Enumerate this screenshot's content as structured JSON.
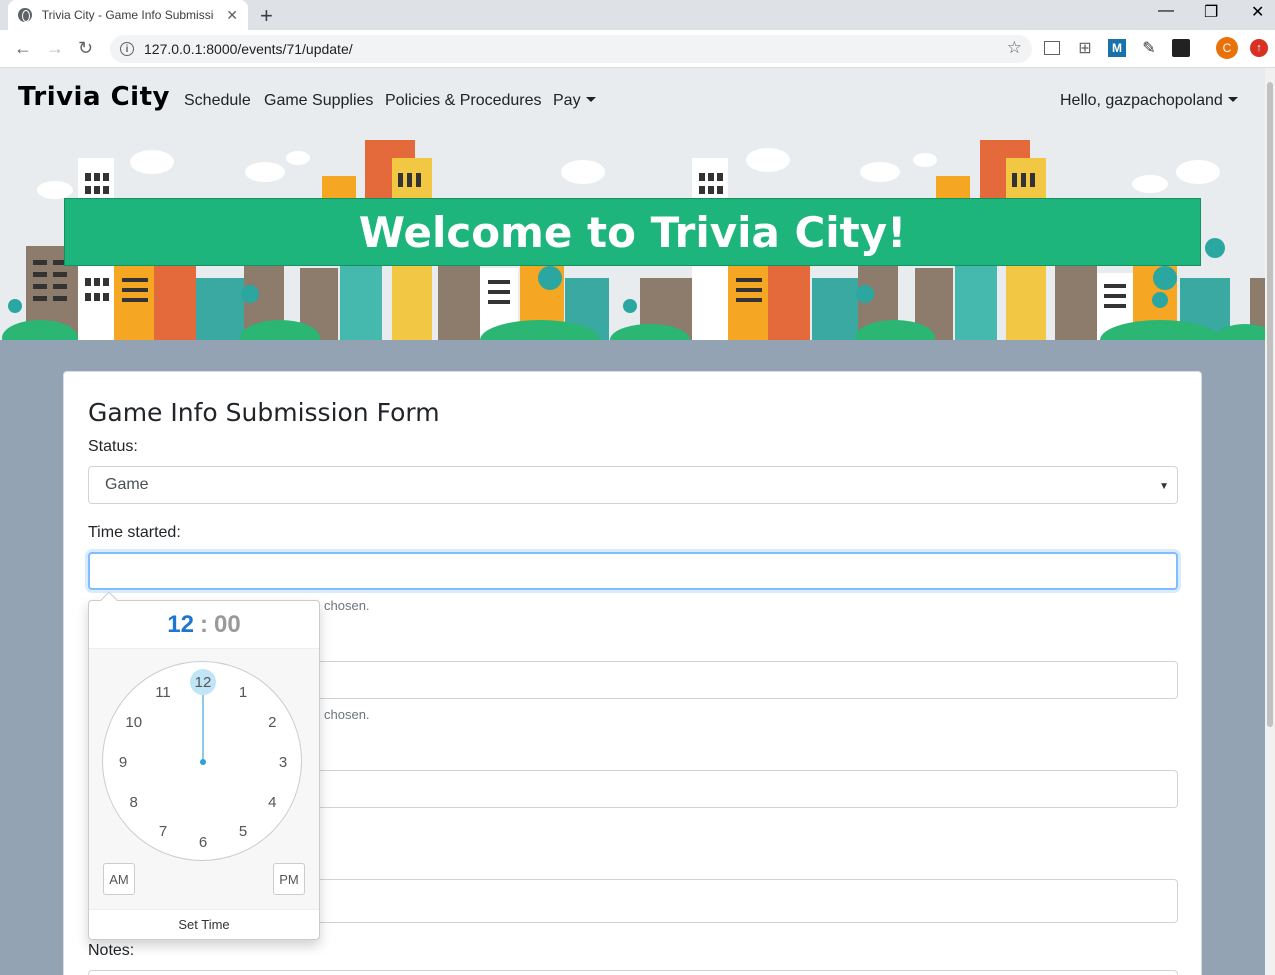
{
  "browser": {
    "tab_title": "Trivia City - Game Info Submissio",
    "tab_close": "✕",
    "new_tab": "+",
    "url": "127.0.0.1:8000/events/71/update/",
    "profile_initial": "C",
    "ext_m": "M"
  },
  "navbar": {
    "brand": "Trivia City",
    "links": [
      "Schedule",
      "Game Supplies",
      "Policies & Procedures",
      "Pay"
    ],
    "user_greeting": "Hello, gazpachopoland"
  },
  "banner": {
    "title": "Welcome to Trivia City!"
  },
  "form": {
    "title": "Game Info Submission Form",
    "status_label": "Status:",
    "status_value": "Game",
    "time_started_label": "Time started:",
    "time_started_value": "",
    "help_1": "chosen.",
    "help_2": "chosen.",
    "notes_label": "Notes:"
  },
  "clock_picker": {
    "hours": "12",
    "separator": ":",
    "minutes": "00",
    "numbers": [
      "12",
      "1",
      "2",
      "3",
      "4",
      "5",
      "6",
      "7",
      "8",
      "9",
      "10",
      "11"
    ],
    "selected": "12",
    "am": "AM",
    "pm": "PM",
    "set_time": "Set Time"
  },
  "colors": {
    "banner": "#1eb57d",
    "page_bg": "#94a3b4",
    "accent": "#1e76d0"
  }
}
